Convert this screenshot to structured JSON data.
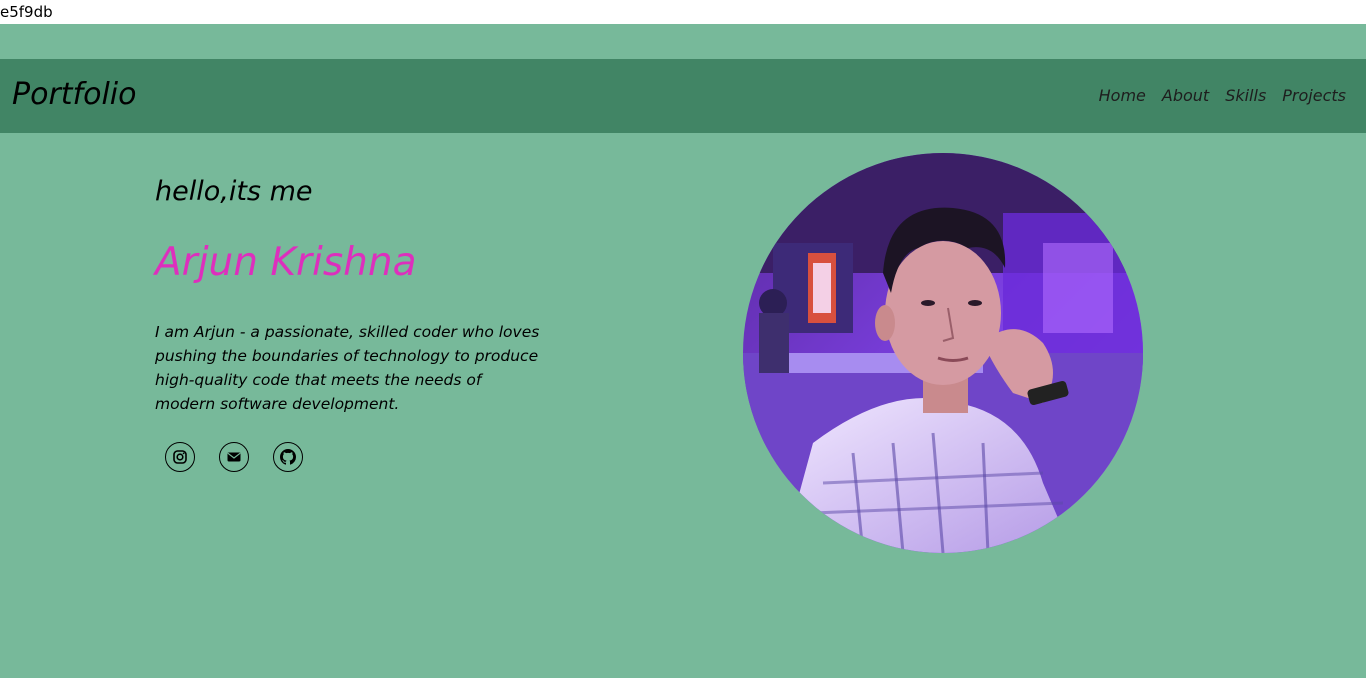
{
  "topbar": {
    "hash_text": "e5f9db"
  },
  "navbar": {
    "brand": "Portfolio",
    "links": [
      "Home",
      "About",
      "Skills",
      "Projects"
    ]
  },
  "hero": {
    "greeting": "hello,its me",
    "name": "Arjun Krishna",
    "bio": "I am Arjun - a passionate, skilled coder who loves pushing the boundaries of technology to produce high-quality code that meets the needs of modern software development.",
    "socials": [
      "instagram-icon",
      "envelope-icon",
      "github-icon"
    ]
  },
  "colors": {
    "page_bg": "#77b99a",
    "navbar_bg": "#418565",
    "name_accent": "#dd2fbd"
  }
}
